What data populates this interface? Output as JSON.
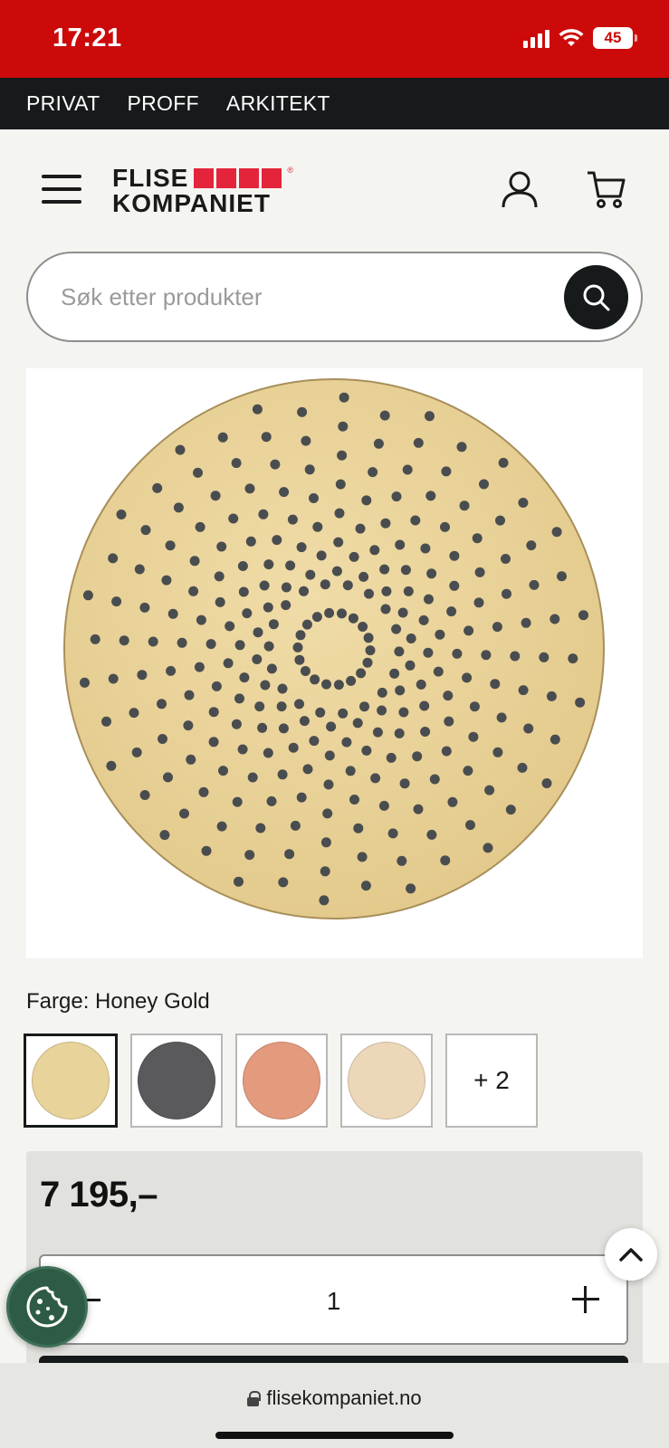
{
  "status_bar": {
    "time": "17:21",
    "battery": "45"
  },
  "top_nav": {
    "items": [
      "PRIVAT",
      "PROFF",
      "ARKITEKT"
    ]
  },
  "logo": {
    "line1": "FLISE",
    "line2": "KOMPANIET"
  },
  "search": {
    "placeholder": "Søk etter produkter"
  },
  "product": {
    "color_label": "Farge: Honey Gold",
    "swatches": [
      {
        "name": "Honey Gold",
        "color": "#e8d39a",
        "selected": true
      },
      {
        "name": "Gunmetal",
        "color": "#5a5a5c"
      },
      {
        "name": "Copper",
        "color": "#e39a7d"
      },
      {
        "name": "Champagne",
        "color": "#ecd7b8"
      }
    ],
    "more_swatches": "+ 2",
    "price": "7 195,–",
    "quantity": "1"
  },
  "browser": {
    "url": "flisekompaniet.no"
  },
  "colors": {
    "brand_red": "#cc0a0a",
    "nav_dark": "#161a1b",
    "logo_red": "#e4243b",
    "cookie_green": "#2e5b45"
  }
}
